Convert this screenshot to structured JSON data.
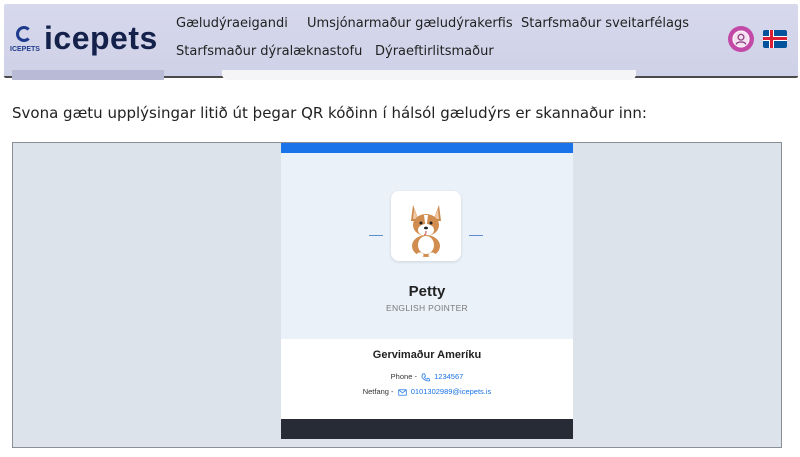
{
  "brand": {
    "name": "icepets",
    "mini_label": "ICEPETS"
  },
  "nav": {
    "items": [
      {
        "label": "Gæludýraeigandi"
      },
      {
        "label": "Umsjónarmaður gæludýrakerfis"
      },
      {
        "label": "Starfsmaður sveitarfélags"
      },
      {
        "label": "Starfsmaður dýralæknastofu"
      },
      {
        "label": "Dýraeftirlitsmaður"
      }
    ]
  },
  "header_icons": {
    "avatar": "user-icon",
    "language": "iceland-flag-icon"
  },
  "colors": {
    "accent": "#1a73e8",
    "brand": "#13214b",
    "footer": "#262b35"
  },
  "intro": {
    "text": "Svona gætu upplýsingar litið út þegar QR kóðinn í hálsól gæludýrs er skannaður inn:"
  },
  "pet_card": {
    "pet_name": "Petty",
    "breed": "ENGLISH POINTER",
    "owner_name": "Gervimaður Ameríku",
    "phone_label": "Phone - ",
    "phone_value": "1234567",
    "email_label": "Netfang - ",
    "email_value": "0101302989@icepets.is"
  }
}
